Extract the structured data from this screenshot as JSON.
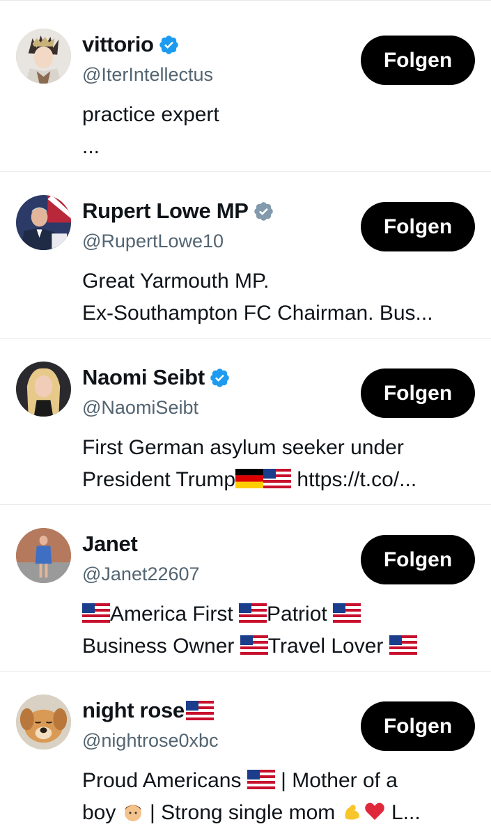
{
  "colors": {
    "verified_blue": "#1d9bf0",
    "verified_gray": "#829aab",
    "follow_bg": "#000000",
    "follow_text": "#ffffff",
    "handle": "#536471",
    "divider": "#e6e9ec"
  },
  "users": [
    {
      "name": "vittorio",
      "verified": "blue",
      "handle": "@IterIntellectus",
      "bio_lines": [
        "practice expert",
        "..."
      ],
      "follow_label": "Folgen",
      "avatar": "anime-avatar"
    },
    {
      "name": "Rupert Lowe MP",
      "verified": "gray",
      "handle": "@RupertLowe10",
      "bio_lines": [
        "Great Yarmouth MP.",
        "Ex-Southampton FC Chairman. Bus..."
      ],
      "follow_label": "Folgen",
      "avatar": "man-portrait"
    },
    {
      "name": "Naomi Seibt",
      "verified": "blue",
      "handle": "@NaomiSeibt",
      "bio_lines": [
        "First German asylum seeker under",
        "President Trump",
        " https://t.co/..."
      ],
      "follow_label": "Folgen",
      "avatar": "woman-portrait"
    },
    {
      "name": "Janet",
      "verified": "none",
      "handle": "@Janet22607",
      "bio_lines": [
        "America First ",
        "Patriot ",
        "Business Owner ",
        "Travel Lover "
      ],
      "follow_label": "Folgen",
      "avatar": "woman-standing"
    },
    {
      "name": "night rose",
      "verified": "none",
      "handle": "@nightrose0xbc",
      "bio_lines": [
        "Proud Americans ",
        " | Mother of a",
        "boy ",
        " | Strong single mom ",
        " L..."
      ],
      "follow_label": "Folgen",
      "avatar": "puppy"
    }
  ]
}
